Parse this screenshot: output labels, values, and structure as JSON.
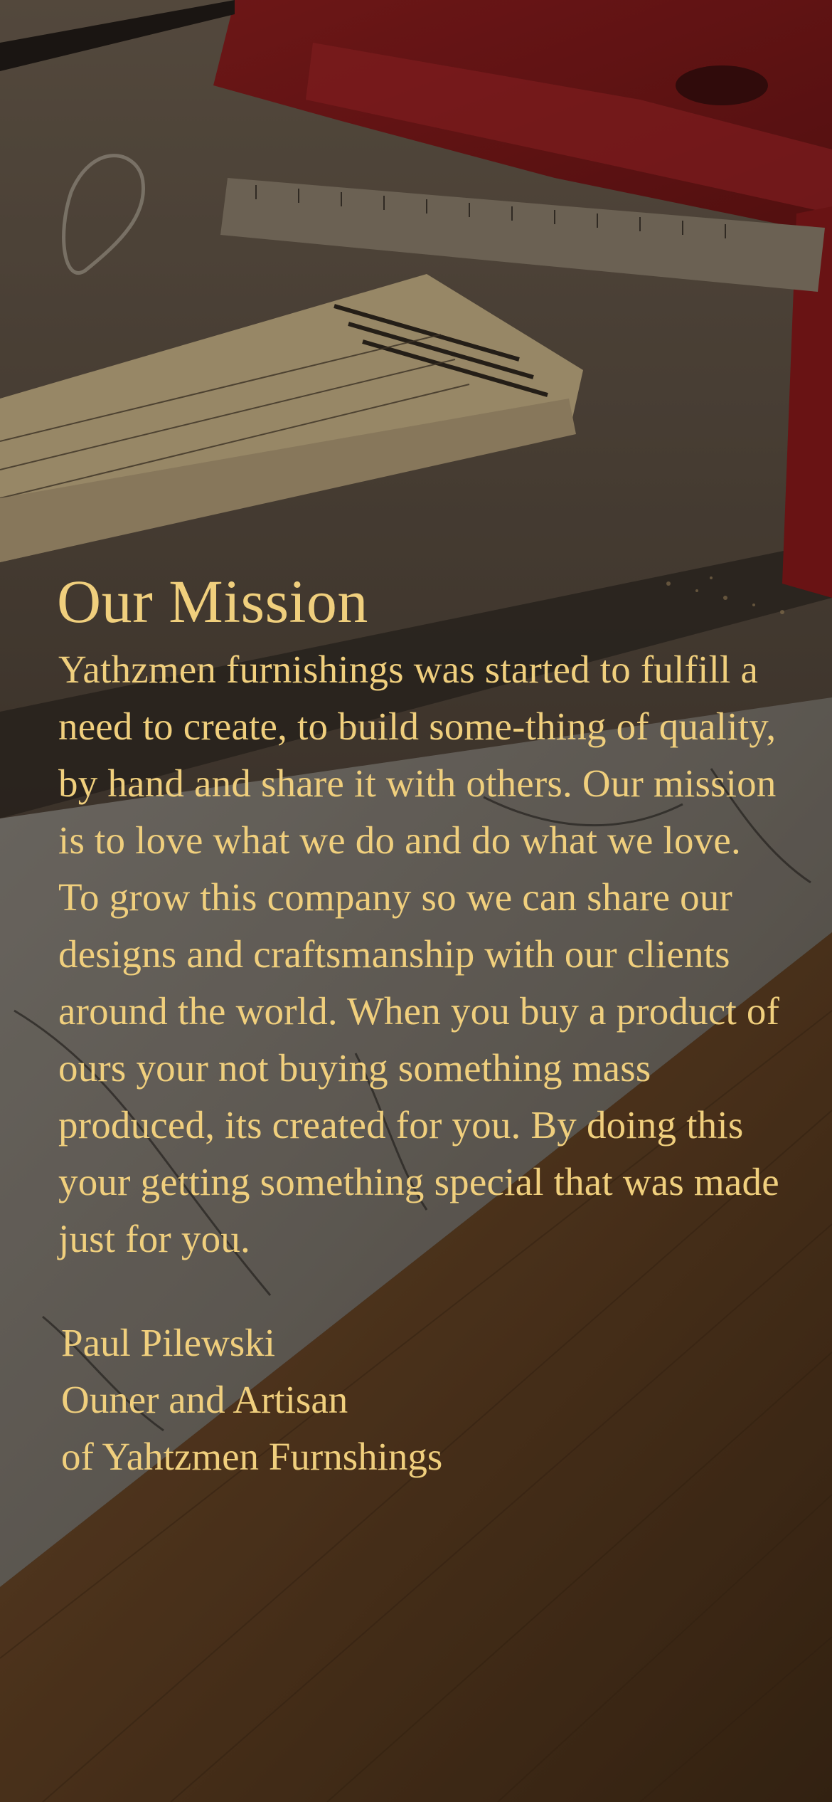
{
  "mission": {
    "title": "Our Mission",
    "body": "Yathzmen furnishings was started to fulfill a need to create, to build some-thing of quality, by hand and share it with others. Our mission is to love what we do and do what we love. To grow this company so we can share our designs and craftsmanship with our clients around the world. When you buy a product of ours your not buying something mass produced, its created for you. By doing this your getting something special that was made just for you."
  },
  "signature": {
    "name": "Paul Pilewski",
    "role": "Ouner and Artisan",
    "company": "of Yahtzmen Furnshings"
  },
  "background": {
    "description_icon": "workshop-photo",
    "text_color": "#f0cf7d"
  }
}
